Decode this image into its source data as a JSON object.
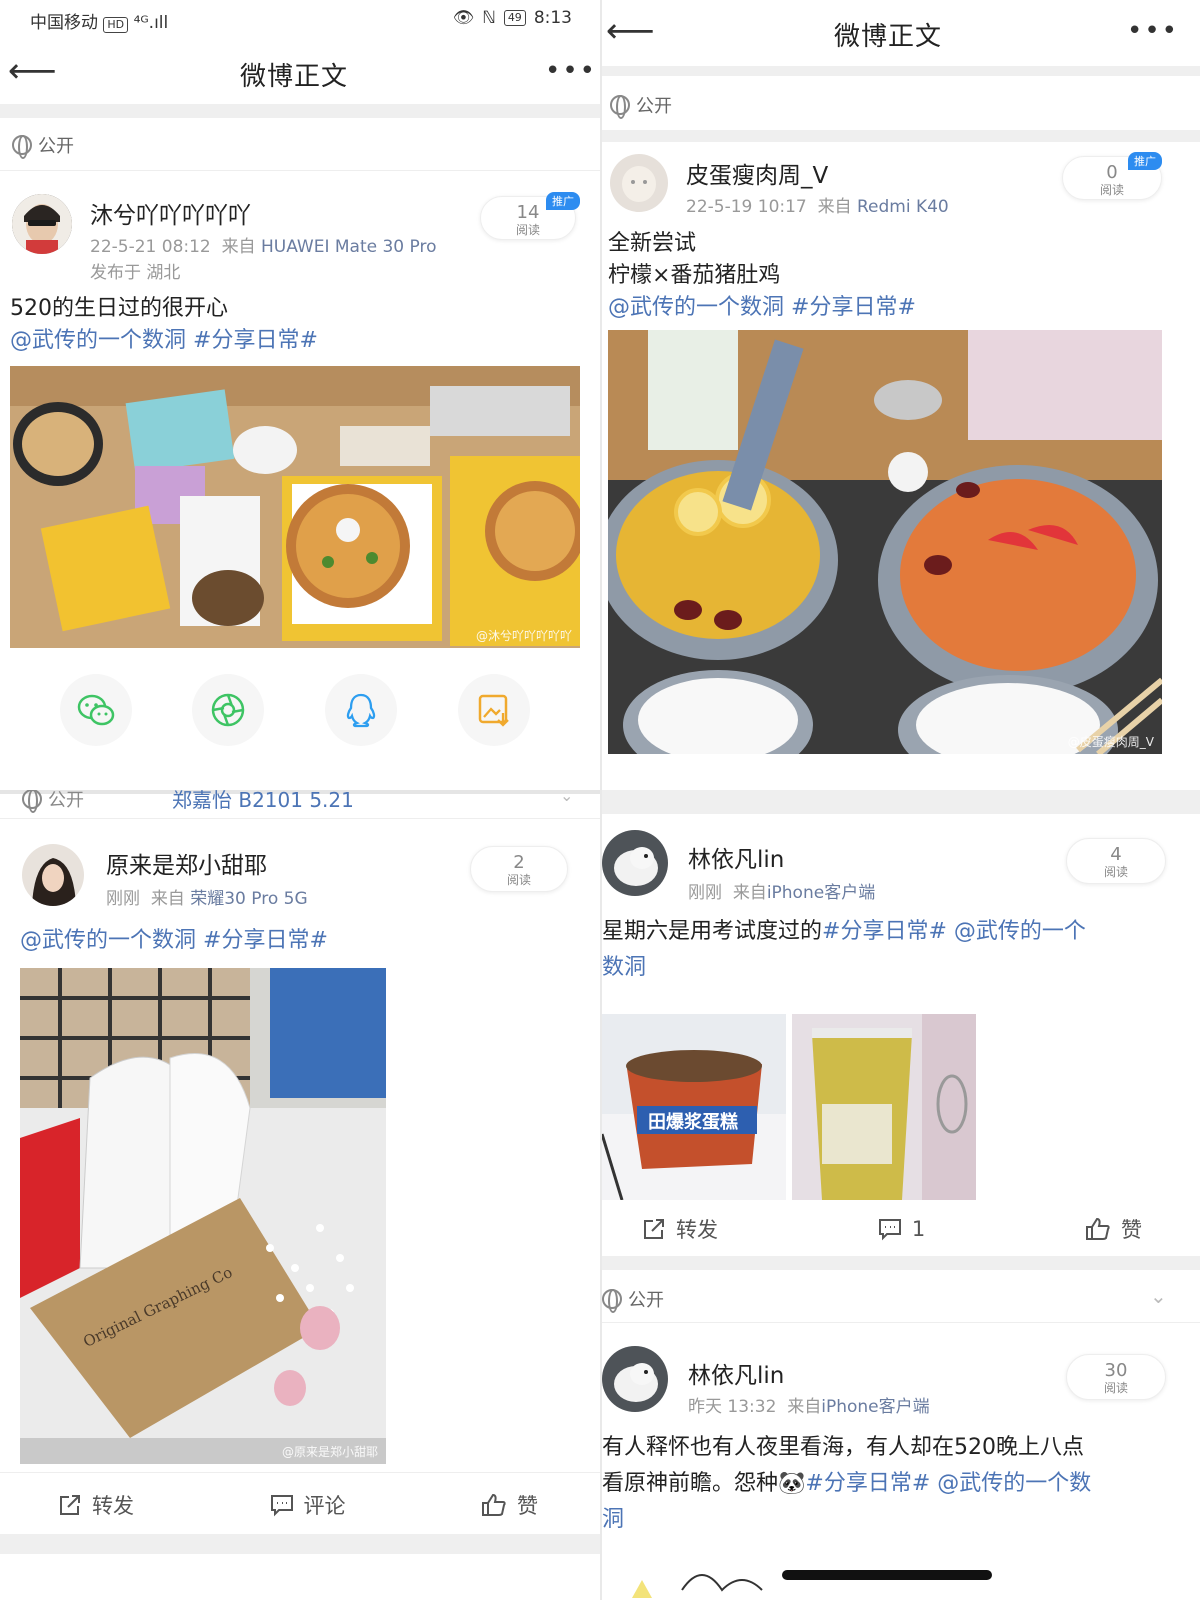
{
  "status_bar": {
    "carrier": "中国移动",
    "hd": "HD",
    "signal": "⁴ᴳ.ıll",
    "battery": "49",
    "time": "8:13"
  },
  "nav": {
    "title": "微博正文",
    "back_icon": "arrow-left-icon",
    "more_icon": "more-dots-icon"
  },
  "visibility": "公开",
  "reads_label": "阅读",
  "promo_badge": "推广",
  "posts": [
    {
      "user": "沐兮吖吖吖吖吖",
      "time": "22-5-21 08:12",
      "from": "来自",
      "device": "HUAWEI Mate 30 Pro",
      "location": "发布于 湖北",
      "reads": "14",
      "text": "520的生日过的很开心",
      "mention": "@武传的一个数洞",
      "topic": "#分享日常#",
      "watermark": "@沐兮吖吖吖吖吖"
    },
    {
      "user": "原来是郑小甜耶",
      "time": "刚刚",
      "from": "来自",
      "device": "荣耀30 Pro 5G",
      "reads": "2",
      "mention": "@武传的一个数洞",
      "topic": "#分享日常#",
      "watermark": "@原来是郑小甜耶",
      "newspaper_text": "Original Graphing Co",
      "overlap_text": "郑嘉怡 B2101 5.21"
    },
    {
      "user": "皮蛋瘦肉周_V",
      "time": "22-5-19 10:17",
      "from": "来自",
      "device": "Redmi K40",
      "reads": "0",
      "line1": "全新尝试",
      "line2": "柠檬×番茄猪肚鸡",
      "mention": "@武传的一个数洞",
      "topic": "#分享日常#",
      "watermark": "@皮蛋瘦肉周_V"
    },
    {
      "user": "林依凡lin",
      "time": "刚刚",
      "from": "来自",
      "device": "iPhone客户端",
      "reads": "4",
      "text": "星期六是用考试度过的",
      "topic": "#分享日常#",
      "mention_a": "@武传的一个",
      "mention_b": "数洞",
      "cup_text": "田爆浆蛋糕",
      "actions": {
        "repost": "转发",
        "comments": "1",
        "like": "赞"
      }
    },
    {
      "user": "林依凡lin",
      "time": "昨天 13:32",
      "from": "来自",
      "device": "iPhone客户端",
      "reads": "30",
      "text_a": "有人释怀也有人夜里看海，有人却在520晚上八点",
      "text_b": "看原神前瞻。怨种",
      "topic": "#分享日常#",
      "mention_a": "@武传的一个数",
      "mention_b": "洞"
    }
  ],
  "left_actions": {
    "repost": "转发",
    "comment": "评论",
    "like": "赞"
  },
  "share_icons": [
    "wechat-icon",
    "moments-icon",
    "qq-icon",
    "save-image-icon"
  ],
  "colors": {
    "link": "#4c74b5",
    "promo": "#2d8cf0",
    "wechat": "#3ec464",
    "qq": "#2d9ef0",
    "save": "#f0a92d"
  }
}
